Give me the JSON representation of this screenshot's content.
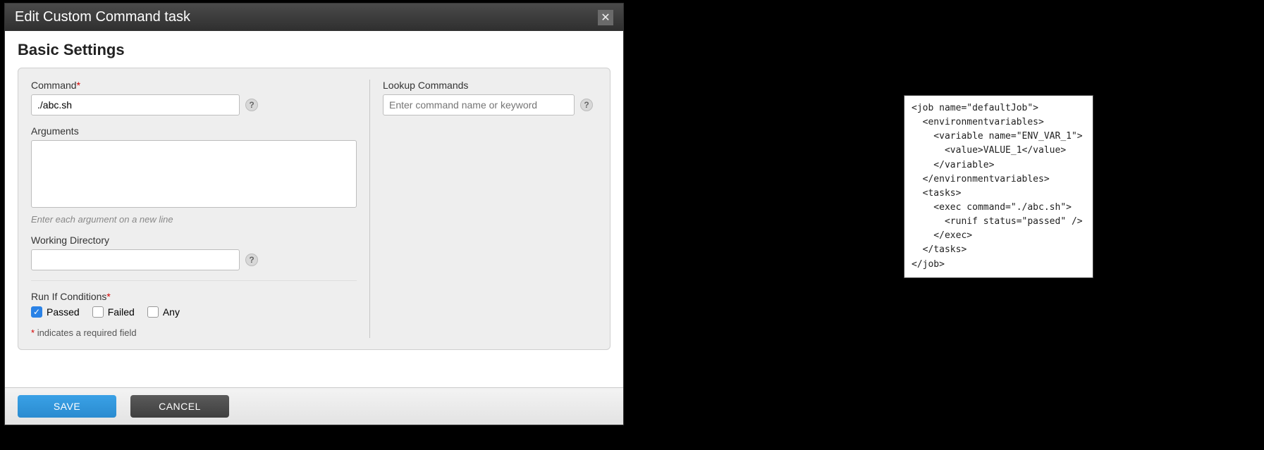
{
  "modal": {
    "title": "Edit Custom Command task",
    "section": "Basic Settings",
    "command": {
      "label": "Command",
      "value": "./abc.sh"
    },
    "lookup": {
      "label": "Lookup Commands",
      "placeholder": "Enter command name or keyword"
    },
    "arguments": {
      "label": "Arguments",
      "value": "",
      "hint": "Enter each argument on a new line"
    },
    "workdir": {
      "label": "Working Directory",
      "value": ""
    },
    "runif": {
      "label": "Run If Conditions",
      "passed": "Passed",
      "failed": "Failed",
      "any": "Any"
    },
    "req_note": "indicates a required field",
    "save": "SAVE",
    "cancel": "CANCEL"
  },
  "code": "<job name=\"defaultJob\">\n  <environmentvariables>\n    <variable name=\"ENV_VAR_1\">\n      <value>VALUE_1</value>\n    </variable>\n  </environmentvariables>\n  <tasks>\n    <exec command=\"./abc.sh\">\n      <runif status=\"passed\" />\n    </exec>\n  </tasks>\n</job>"
}
